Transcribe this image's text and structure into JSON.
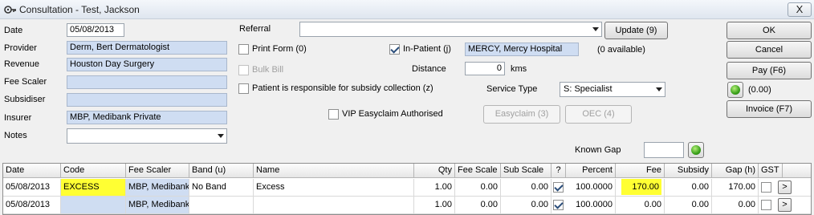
{
  "window": {
    "title": "Consultation - Test, Jackson",
    "close_label": "X"
  },
  "labels": {
    "date": "Date",
    "provider": "Provider",
    "revenue": "Revenue",
    "fee_scaler": "Fee Scaler",
    "subsidiser": "Subsidiser",
    "insurer": "Insurer",
    "notes": "Notes",
    "referral": "Referral",
    "distance": "Distance",
    "kms": "kms",
    "service_type": "Service Type",
    "known_gap": "Known Gap"
  },
  "fields": {
    "date": "05/08/2013",
    "provider": "Derm, Bert  Dermatologist",
    "revenue": "Houston Day Surgery",
    "fee_scaler": "",
    "subsidiser": "",
    "insurer": "MBP, Medibank Private",
    "notes": "",
    "referral": "",
    "hospital": "MERCY, Mercy Hospital",
    "distance": "0",
    "service_type": "S: Specialist",
    "known_gap": ""
  },
  "checkboxes": {
    "print_form": "Print Form (0)",
    "bulk_bill": "Bulk Bill",
    "in_patient": "In-Patient (j)",
    "subsidy_responsible": "Patient is responsible for subsidy collection (z)",
    "vip_easyclaim": "VIP Easyclaim Authorised"
  },
  "buttons": {
    "update": "Update (9)",
    "available": "(0 available)",
    "ok": "OK",
    "cancel": "Cancel",
    "pay": "Pay (F6)",
    "balance": "(0.00)",
    "invoice": "Invoice (F7)",
    "easyclaim": "Easyclaim (3)",
    "oec": "OEC (4)"
  },
  "table": {
    "columns": [
      "Date",
      "Code",
      "Fee Scaler",
      "Band (u)",
      "Name",
      "Qty",
      "Fee Scale",
      "Sub Scale",
      "?",
      "Percent",
      "Fee",
      "Subsidy",
      "Gap (h)",
      "GST"
    ],
    "rows": [
      {
        "date": "05/08/2013",
        "code": "EXCESS",
        "fee_scaler": "MBP, Medibank",
        "band": "No Band",
        "name": "Excess",
        "qty": "1.00",
        "fee_scale": "0.00",
        "sub_scale": "0.00",
        "q": true,
        "percent": "100.0000",
        "fee": "170.00",
        "subsidy": "0.00",
        "gap": "170.00",
        "gst": false,
        "action": ">"
      },
      {
        "date": "05/08/2013",
        "code": "",
        "fee_scaler": "MBP, Medibank",
        "band": "",
        "name": "",
        "qty": "1.00",
        "fee_scale": "0.00",
        "sub_scale": "0.00",
        "q": true,
        "percent": "100.0000",
        "fee": "0.00",
        "subsidy": "0.00",
        "gap": "0.00",
        "gst": false,
        "action": ">"
      }
    ]
  },
  "colors": {
    "field_blue": "#cfddf2",
    "highlight_yellow": "#ffff33",
    "status_green": "#3aa11a"
  },
  "icons": {
    "window": "key-icon",
    "close": "close-icon",
    "dropdown": "chevron-down-icon",
    "status": "green-circle-icon"
  }
}
